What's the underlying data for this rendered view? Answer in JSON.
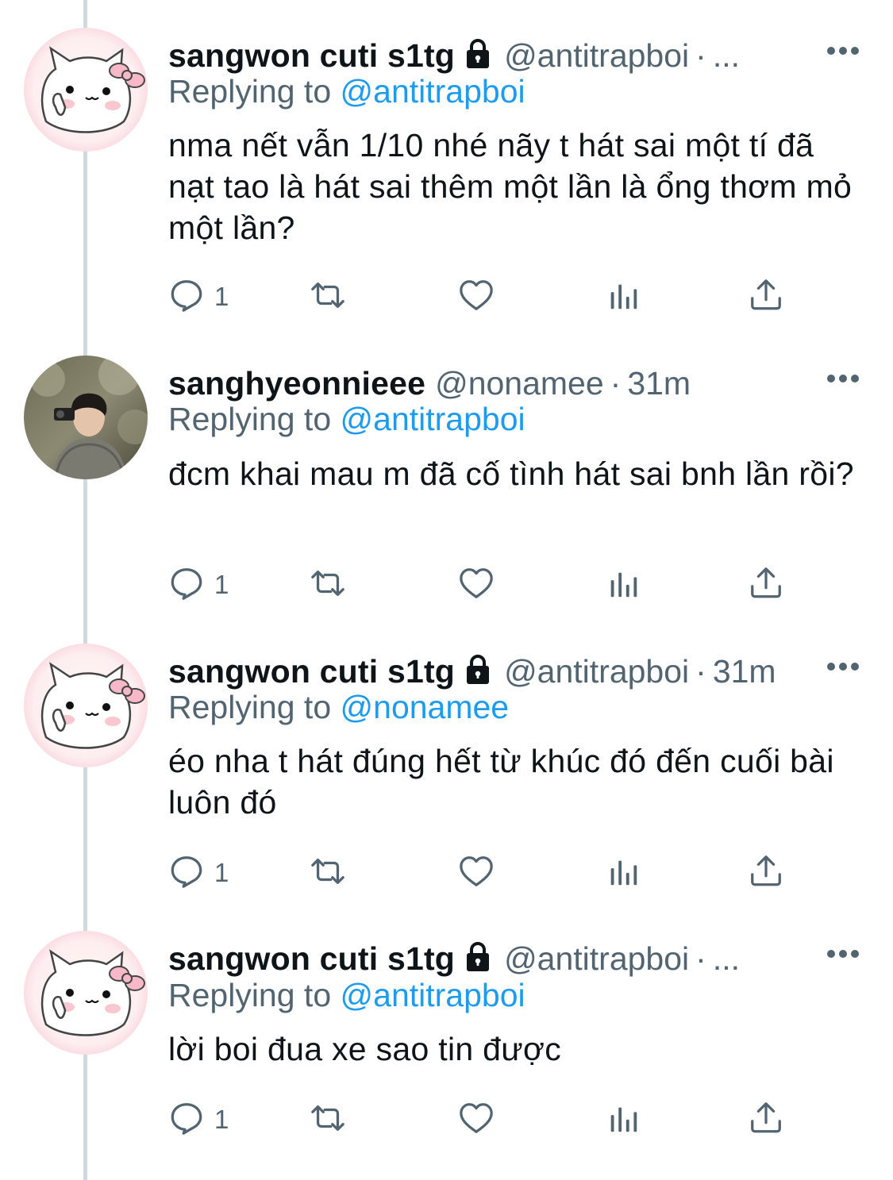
{
  "tweets": [
    {
      "display_name": "sangwon cuti s1tg",
      "locked": true,
      "handle": "@antitrapboi",
      "separator": "·",
      "time": "...",
      "reply_prefix": "Replying to ",
      "reply_to": "@antitrapboi",
      "text": "nma nết vẫn 1/10 nhé nãy t hát sai một tí đã nạt tao là hát sai thêm một lần là ổng thơm mỏ một lần?",
      "reply_count": "1",
      "avatar": "hello-kitty-avatar"
    },
    {
      "display_name": "sanghyeonnieee",
      "locked": false,
      "handle": "@nonamee",
      "separator": "·",
      "time": "31m",
      "reply_prefix": "Replying to ",
      "reply_to": "@antitrapboi",
      "text": "đcm khai mau m đã cố tình hát sai bnh lần rồi?",
      "reply_count": "1",
      "avatar": "photo-avatar"
    },
    {
      "display_name": "sangwon cuti s1tg",
      "locked": true,
      "handle": "@antitrapboi",
      "separator": "·",
      "time": "31m",
      "reply_prefix": "Replying to ",
      "reply_to": "@nonamee",
      "text": "éo nha t hát đúng hết từ khúc đó đến cuối bài luôn đó",
      "reply_count": "1",
      "avatar": "hello-kitty-avatar"
    },
    {
      "display_name": "sangwon cuti s1tg",
      "locked": true,
      "handle": "@antitrapboi",
      "separator": "·",
      "time": "...",
      "reply_prefix": "Replying to ",
      "reply_to": "@antitrapboi",
      "text": "lời boi đua xe sao tin được",
      "reply_count": "1",
      "avatar": "hello-kitty-avatar"
    }
  ],
  "colors": {
    "text": "#0f1419",
    "secondary": "#536471",
    "link": "#1d9bf0",
    "thread_line": "#cfd9de"
  },
  "icons": [
    "reply-icon",
    "retweet-icon",
    "like-icon",
    "analytics-icon",
    "share-icon",
    "lock-icon",
    "more-icon"
  ]
}
